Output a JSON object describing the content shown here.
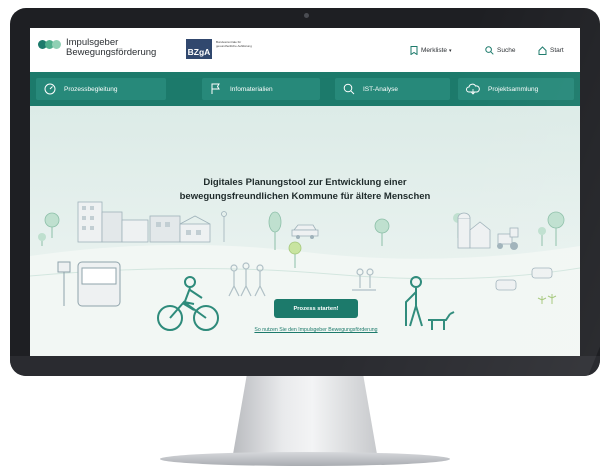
{
  "header": {
    "logo_line1": "Impulsgeber",
    "logo_line2": "Bewegungsförderung",
    "partner_logo": "BZgA",
    "partner_subtitle": "Bundeszentrale für gesundheitliche Aufklärung",
    "links": [
      {
        "label": "Merkliste",
        "icon": "bookmark-icon"
      },
      {
        "label": "Suche",
        "icon": "search-icon"
      },
      {
        "label": "Start",
        "icon": "home-icon"
      }
    ]
  },
  "nav": [
    {
      "label": "Prozessbegleitung",
      "icon": "compass-icon"
    },
    {
      "label": "Infomaterialien",
      "icon": "flag-icon"
    },
    {
      "label": "IST-Analyse",
      "icon": "search-icon"
    },
    {
      "label": "Projektsammlung",
      "icon": "cloud-icon"
    }
  ],
  "hero": {
    "headline_line1": "Digitales Planungstool zur Entwicklung einer",
    "headline_line2": "bewegungsfreundlichen Kommune für ältere Menschen",
    "cta_label": "Prozess starten!",
    "link_label": "So nutzen Sie den Impulsgeber Bewegungsförderung"
  },
  "colors": {
    "brand_green": "#1c7a6b",
    "logo_dot_1": "#1c7a6b",
    "logo_dot_2": "#4fae8c",
    "logo_dot_3": "#8fd0b4",
    "partner_blue": "#31486e"
  }
}
